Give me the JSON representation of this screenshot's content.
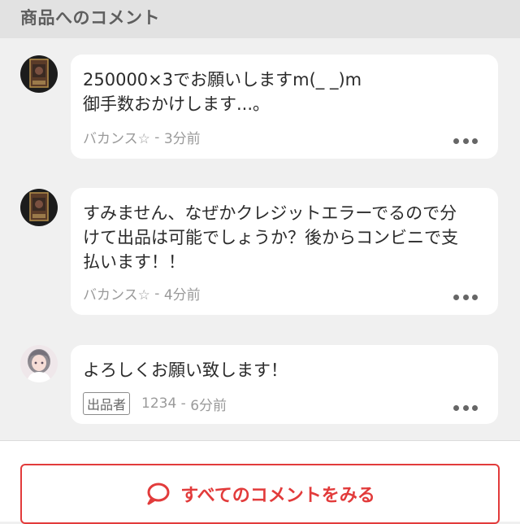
{
  "header": {
    "title": "商品へのコメント"
  },
  "comments": [
    {
      "text_lines": [
        "250000×3でお願いしますm(_ _)m",
        "御手数おかけします...。"
      ],
      "author": "バカンス☆",
      "time": "3分前",
      "seller": false
    },
    {
      "text_lines": [
        "すみません、なぜかクレジットエラーでるので分",
        "けて出品は可能でしょうか？後からコンビニで支",
        "払います！！"
      ],
      "author": "バカンス☆",
      "time": "4分前",
      "seller": false
    },
    {
      "text_lines": [
        "よろしくお願い致します！"
      ],
      "author": "1234",
      "time": "6分前",
      "seller": true,
      "seller_badge": "出品者"
    }
  ],
  "meta_separator": " - ",
  "footer": {
    "all_comments_label": "すべてのコメントをみる"
  },
  "colors": {
    "accent": "#e23b3b",
    "header_bg": "#e2e2e2",
    "page_bg": "#f0f0f0"
  }
}
